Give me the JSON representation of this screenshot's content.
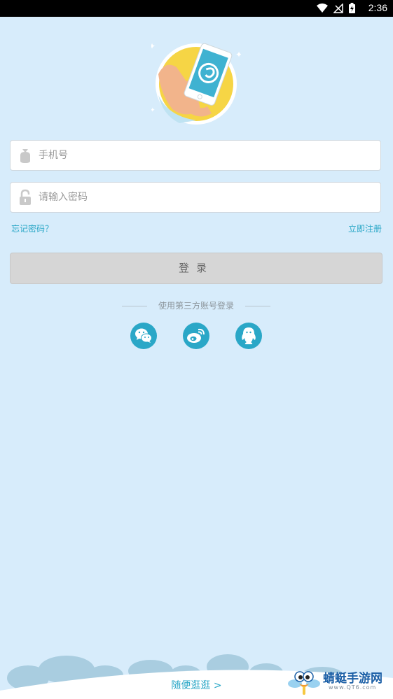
{
  "status_bar": {
    "time": "2:36",
    "icons": [
      "wifi-icon",
      "no-signal-icon",
      "battery-charging-icon"
    ]
  },
  "logo": {
    "icon": "hand-holding-phone-logo"
  },
  "phone_field": {
    "placeholder": "手机号",
    "icon": "user-bag-icon"
  },
  "password_field": {
    "placeholder": "请输入密码",
    "icon": "lock-icon"
  },
  "links": {
    "forgot": "忘记密码？",
    "register": "立即注册"
  },
  "login_button": {
    "label": "登录"
  },
  "third_party": {
    "label": "使用第三方账号登录",
    "providers": [
      "wechat-icon",
      "weibo-icon",
      "qq-icon"
    ]
  },
  "browse": {
    "label": "随便逛逛 >"
  },
  "watermark": {
    "name": "蜻蜓手游网",
    "site": "www.QT6.com"
  },
  "colors": {
    "background": "#d7ecfb",
    "accent": "#2aa7c7",
    "button": "#d6d6d6"
  }
}
